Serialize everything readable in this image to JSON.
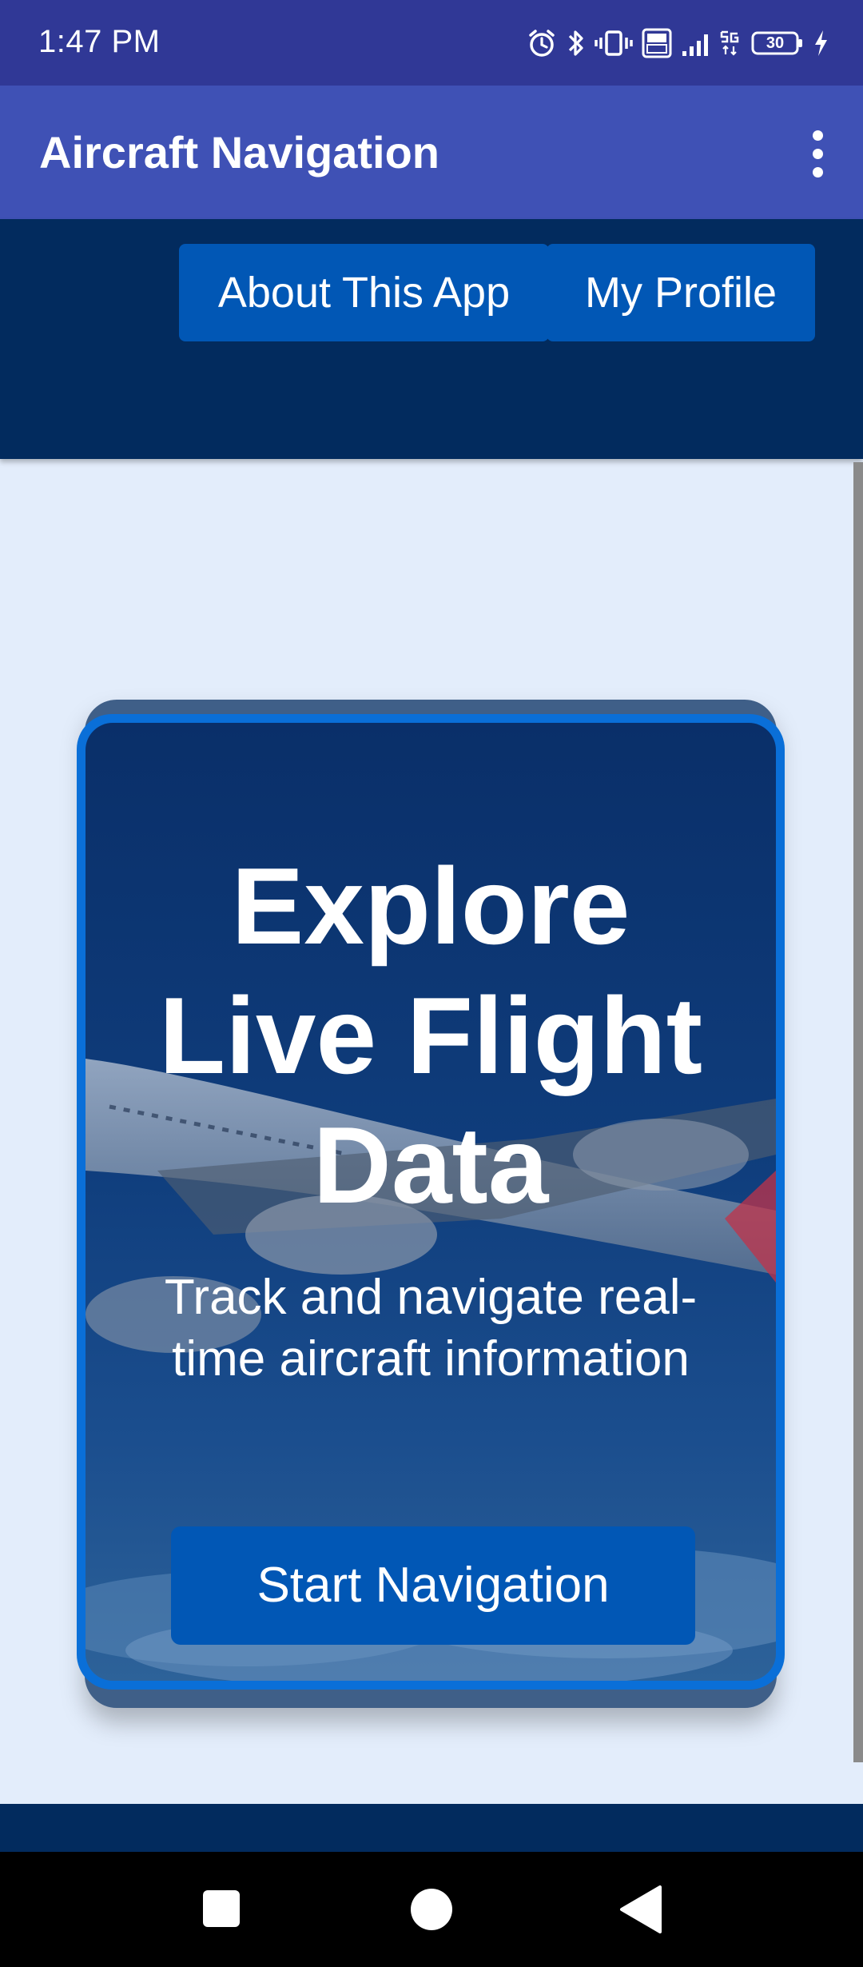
{
  "status_bar": {
    "time": "1:47 PM",
    "battery_level": "30",
    "icons": [
      "alarm-icon",
      "bluetooth-icon",
      "vibrate-icon",
      "volte-icon",
      "signal-icon",
      "5g-icon",
      "battery-icon",
      "charging-icon"
    ]
  },
  "app_bar": {
    "title": "Aircraft Navigation",
    "overflow_icon": "more-vert-icon"
  },
  "nav": {
    "about_label": "About This App",
    "profile_label": "My Profile"
  },
  "hero": {
    "title": "Explore Live Flight Data",
    "subtitle": "Track and navigate real-time aircraft information",
    "cta_label": "Start Navigation"
  },
  "system_nav": {
    "recents_icon": "square-icon",
    "home_icon": "circle-icon",
    "back_icon": "triangle-back-icon"
  },
  "colors": {
    "status_bar": "#303896",
    "app_bar": "#3f51b5",
    "header_bg": "#022b5e",
    "button_bg": "#0157b5",
    "card_border": "#0a6fd8",
    "page_bg": "#e3edfb"
  }
}
